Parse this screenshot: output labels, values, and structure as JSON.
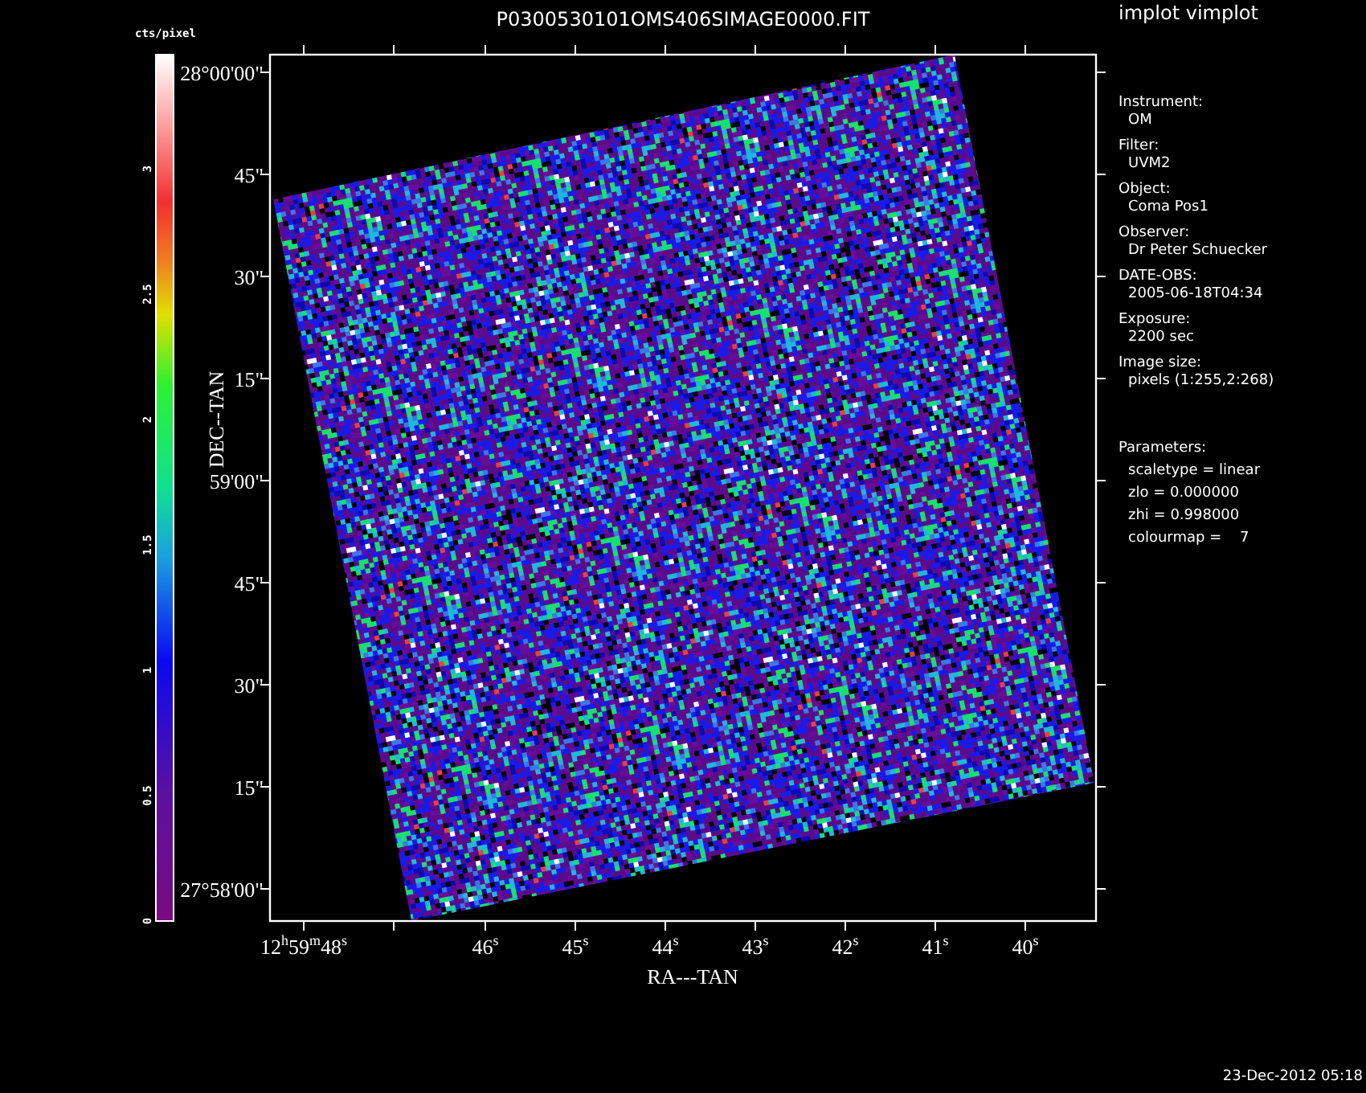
{
  "title": "P0300530101OMS406SIMAGE0000.FIT",
  "app_label": "implot vimplot",
  "colorbar": {
    "unit": "cts/pixel",
    "ticks": [
      "0",
      "0.5",
      "1",
      "1.5",
      "2",
      "2.5",
      "3"
    ]
  },
  "y_axis": {
    "label": "DEC--TAN",
    "ticks": [
      "28°00'00\"",
      "45\"",
      "30\"",
      "15\"",
      "59'00\"",
      "45\"",
      "30\"",
      "15\"",
      "27°58'00\""
    ]
  },
  "x_axis": {
    "label": "RA---TAN",
    "ticks": [
      "12$^{h}$59$^{m}$48$^{s}$",
      "46$^{s}$",
      "45$^{s}$",
      "44$^{s}$",
      "43$^{s}$",
      "42$^{s}$",
      "41$^{s}$",
      "40$^{s}$"
    ]
  },
  "info": [
    {
      "label": "Instrument:",
      "value": "OM"
    },
    {
      "label": "Filter:",
      "value": "UVM2"
    },
    {
      "label": "Object:",
      "value": "Coma Pos1"
    },
    {
      "label": "Observer:",
      "value": "Dr Peter Schuecker"
    },
    {
      "label": "DATE-OBS:",
      "value": "2005-06-18T04:34"
    },
    {
      "label": "Exposure:",
      "value": "2200 sec"
    },
    {
      "label": "Image size:",
      "value": "pixels (1:255,2:268)"
    }
  ],
  "parameters": {
    "label": "Parameters:",
    "lines": [
      "scaletype = linear",
      "zlo = 0.000000",
      "zhi = 0.998000",
      "colourmap =    7"
    ]
  },
  "timestamp": "23-Dec-2012 05:18"
}
